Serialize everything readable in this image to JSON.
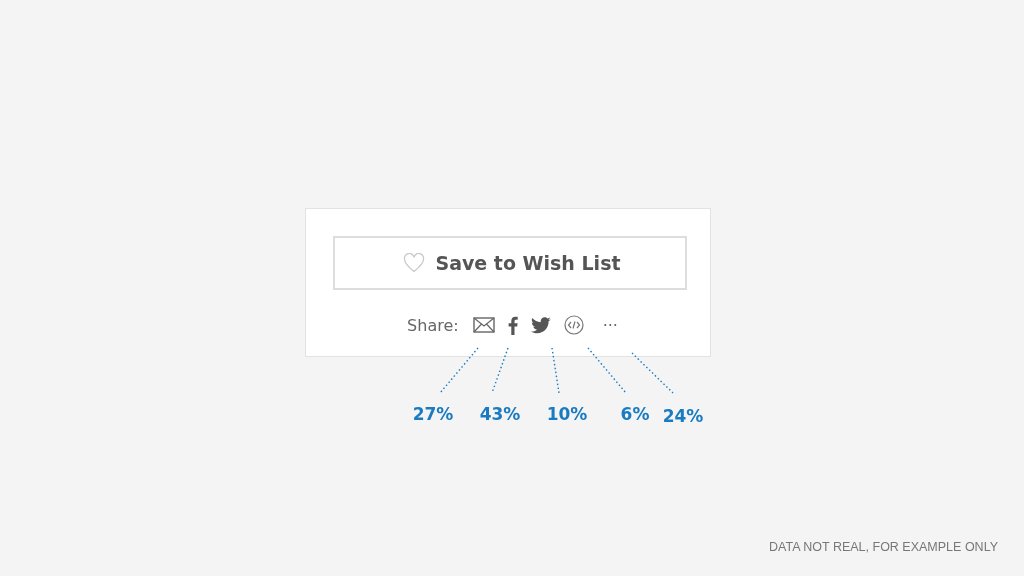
{
  "card": {
    "button": {
      "label": "Save to Wish List"
    },
    "share": {
      "label": "Share:",
      "items": [
        {
          "kind": "mail",
          "share": "27%"
        },
        {
          "kind": "facebook",
          "share": "43%"
        },
        {
          "kind": "twitter",
          "share": "10%"
        },
        {
          "kind": "embed",
          "share": "6%"
        },
        {
          "kind": "more",
          "text": "···",
          "share": "24%"
        }
      ]
    }
  },
  "footnote": "DATA NOT REAL, FOR EXAMPLE ONLY"
}
